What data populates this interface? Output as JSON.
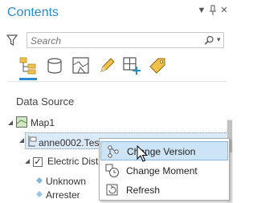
{
  "panel": {
    "title": "Contents",
    "controls": {
      "options": "▼",
      "pin": "📌",
      "close": "✕"
    }
  },
  "search": {
    "placeholder": "Search",
    "value": ""
  },
  "toolbar": {
    "buttons": [
      {
        "id": "list-by-drawing-order",
        "selected": true
      },
      {
        "id": "list-by-data-source",
        "selected": false
      },
      {
        "id": "list-by-editing",
        "selected": false
      },
      {
        "id": "list-by-snapping",
        "selected": false
      },
      {
        "id": "list-by-labeling",
        "selected": false
      }
    ]
  },
  "section_label": "Data Source",
  "tree": {
    "map": {
      "label": "Map1"
    },
    "data_source": {
      "label": "anne0002.TestAV (Naperville_Electric_SQL)"
    },
    "layer": {
      "label": "Electric Distribution Device",
      "checked": true
    },
    "sublayers": [
      {
        "label": "Unknown",
        "symbol_color": "#7fb7d9"
      },
      {
        "label": "Arrester",
        "symbol_color": "#9ac6e6"
      }
    ]
  },
  "context_menu": {
    "items": [
      {
        "label": "Change Version",
        "icon": "change-version-icon",
        "active": true
      },
      {
        "label": "Change Moment",
        "icon": "change-moment-icon",
        "active": false
      },
      {
        "label": "Refresh",
        "icon": "refresh-icon",
        "active": false
      }
    ]
  },
  "colors": {
    "accent": "#2a8dd4",
    "selection": "#dbeaf8",
    "menu_hover": "#cde4f7"
  }
}
